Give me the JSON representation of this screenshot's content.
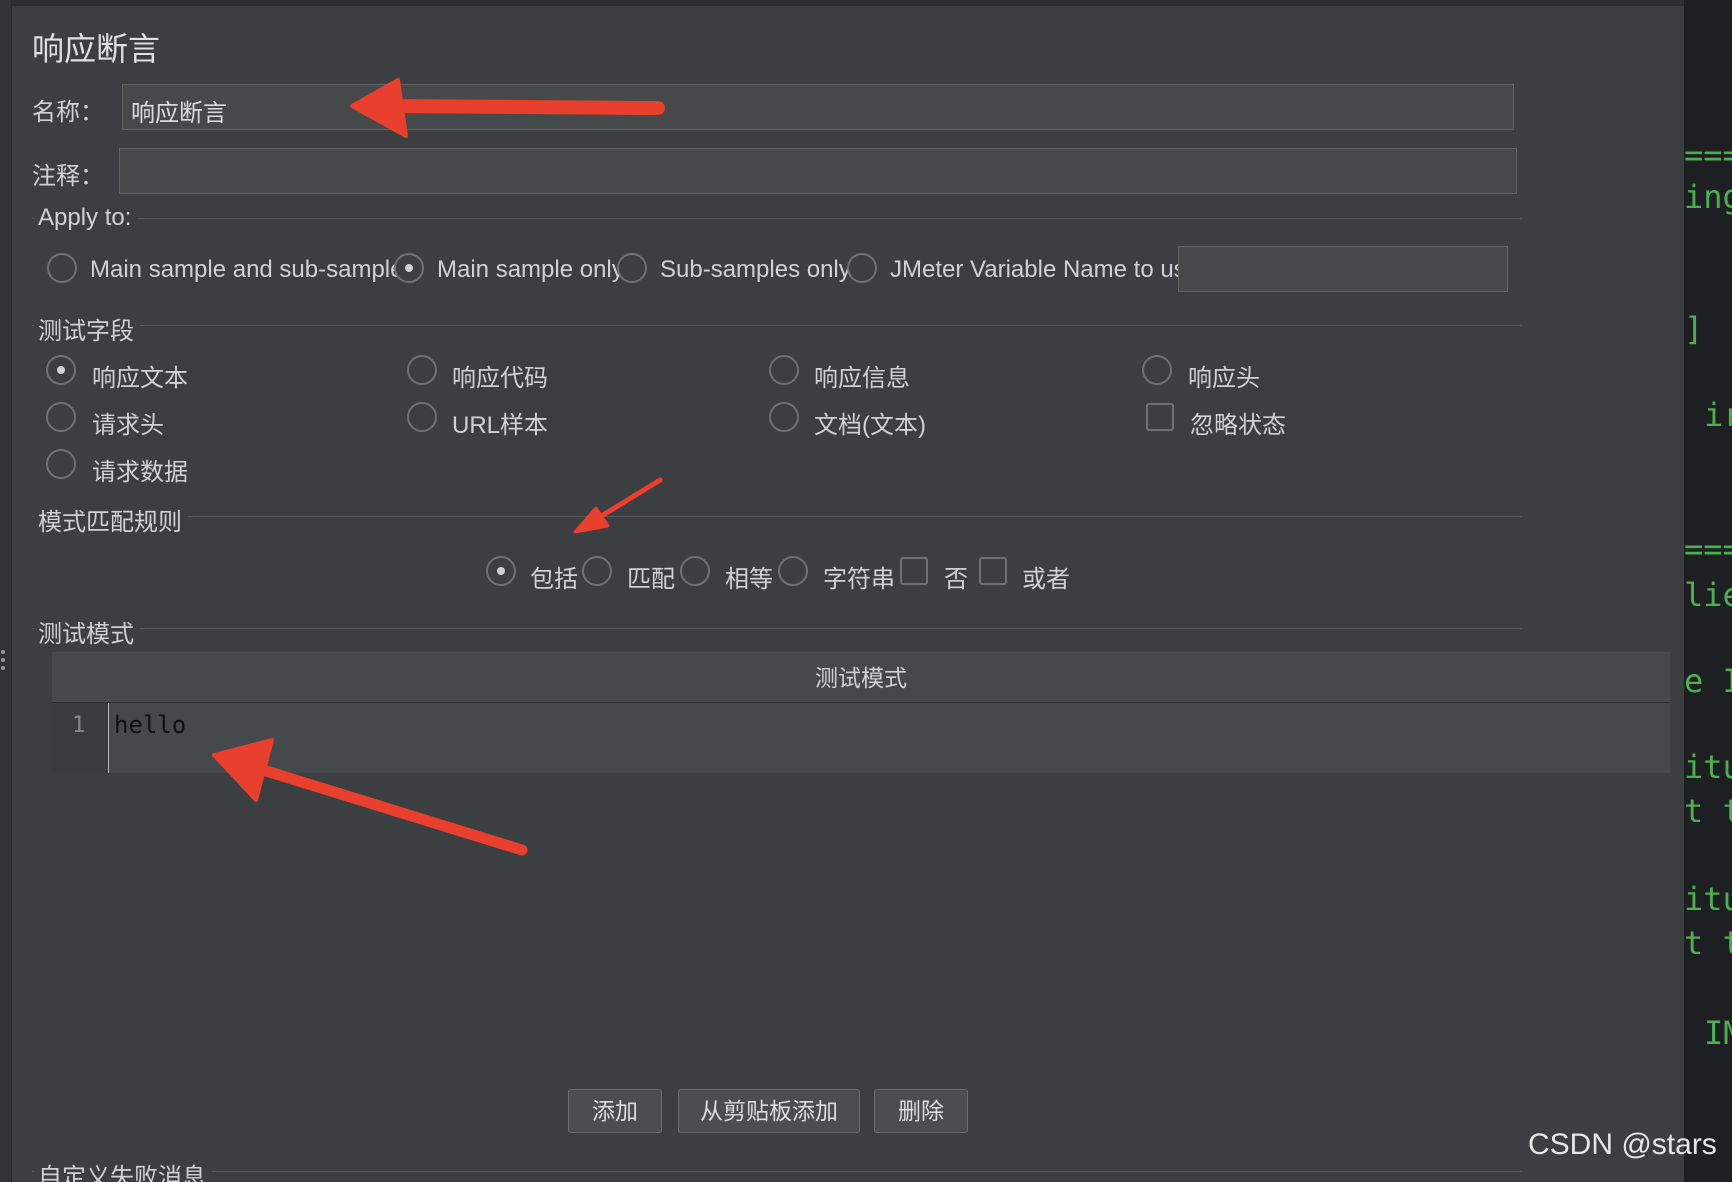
{
  "panel": {
    "title": "响应断言"
  },
  "name_field": {
    "label": "名称：",
    "value": "响应断言"
  },
  "comment_field": {
    "label": "注释：",
    "value": ""
  },
  "apply_to": {
    "title": "Apply to:",
    "options": [
      {
        "label": "Main sample and sub-samples",
        "selected": false
      },
      {
        "label": "Main sample only",
        "selected": true
      },
      {
        "label": "Sub-samples only",
        "selected": false
      },
      {
        "label": "JMeter Variable Name to use",
        "selected": false
      }
    ],
    "variable_value": ""
  },
  "test_field": {
    "title": "测试字段",
    "options": [
      {
        "label": "响应文本",
        "selected": true
      },
      {
        "label": "响应代码",
        "selected": false
      },
      {
        "label": "响应信息",
        "selected": false
      },
      {
        "label": "响应头",
        "selected": false
      },
      {
        "label": "请求头",
        "selected": false
      },
      {
        "label": "URL样本",
        "selected": false
      },
      {
        "label": "文档(文本)",
        "selected": false
      },
      {
        "label": "请求数据",
        "selected": false
      }
    ],
    "ignore_status": {
      "label": "忽略状态",
      "checked": false
    }
  },
  "pattern_rules": {
    "title": "模式匹配规则",
    "options": [
      {
        "label": "包括",
        "selected": true
      },
      {
        "label": "匹配",
        "selected": false
      },
      {
        "label": "相等",
        "selected": false
      },
      {
        "label": "字符串",
        "selected": false
      }
    ],
    "not": {
      "label": "否",
      "checked": false
    },
    "or": {
      "label": "或者",
      "checked": false
    }
  },
  "test_patterns": {
    "title": "测试模式",
    "column_header": "测试模式",
    "rows": [
      {
        "line": "1",
        "text": "hello"
      }
    ]
  },
  "buttons": {
    "add": "添加",
    "add_clipboard": "从剪贴板添加",
    "delete": "删除"
  },
  "failure_message": {
    "title": "自定义失败消息"
  },
  "side_code": [
    "===",
    "ing",
    "]",
    "ir",
    "===",
    "lie",
    "e I",
    "itu",
    "t t",
    "itu",
    "t t",
    "IM"
  ],
  "watermark": "CSDN @stars"
}
